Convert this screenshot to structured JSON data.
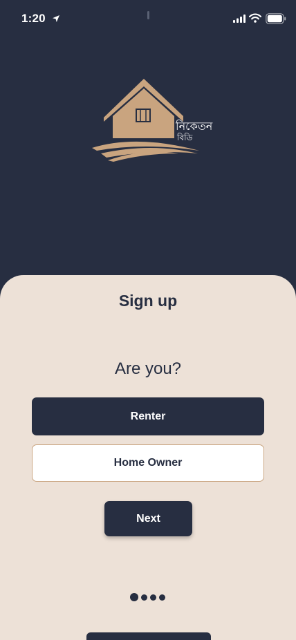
{
  "status_bar": {
    "time": "1:20",
    "icons": [
      "location-arrow-icon",
      "cellular-signal-icon",
      "wifi-icon",
      "battery-icon"
    ]
  },
  "logo": {
    "line_1": "নিকেতন",
    "line_2": "বিডি",
    "icon": "house-logo-icon",
    "color": "#c9a47f"
  },
  "signup": {
    "title": "Sign up",
    "question": "Are you?",
    "options": [
      {
        "label": "Renter",
        "selected": true
      },
      {
        "label": "Home Owner",
        "selected": false
      }
    ],
    "next_label": "Next"
  },
  "pagination": {
    "total": 4,
    "current": 1
  },
  "colors": {
    "navy": "#272e41",
    "cream": "#ede1d7",
    "tan": "#c9a47f",
    "white": "#ffffff"
  }
}
